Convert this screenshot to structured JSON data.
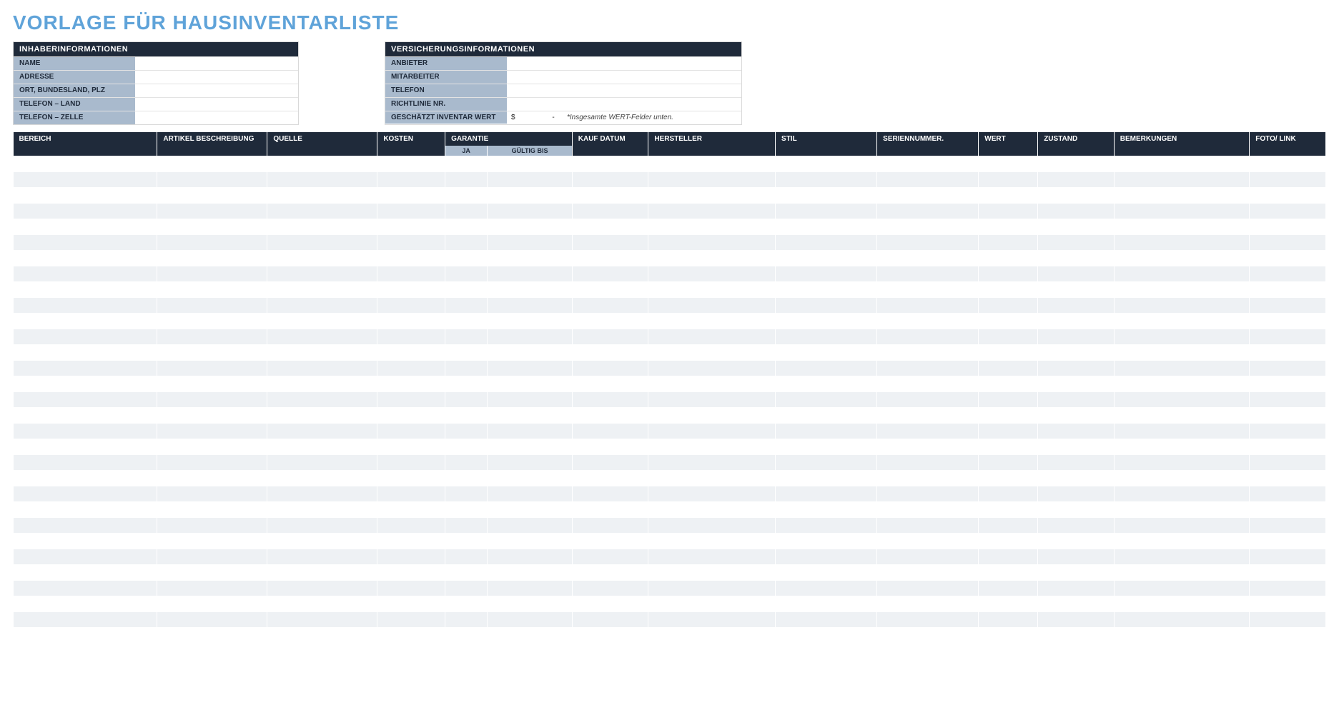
{
  "title": "VORLAGE FÜR HAUSINVENTARLISTE",
  "owner": {
    "header": "INHABERINFORMATIONEN",
    "rows": [
      {
        "label": "NAME",
        "value": ""
      },
      {
        "label": "ADRESSE",
        "value": ""
      },
      {
        "label": "ORT, BUNDESLAND, PLZ",
        "value": ""
      },
      {
        "label": "TELEFON – LAND",
        "value": ""
      },
      {
        "label": "TELEFON – ZELLE",
        "value": ""
      }
    ]
  },
  "insurance": {
    "header": "VERSICHERUNGSINFORMATIONEN",
    "rows": [
      {
        "label": "ANBIETER",
        "value": ""
      },
      {
        "label": "MITARBEITER",
        "value": ""
      },
      {
        "label": "TELEFON",
        "value": ""
      },
      {
        "label": "RICHTLINIE NR.",
        "value": ""
      }
    ],
    "estimate": {
      "label": "GESCHÄTZT INVENTAR WERT",
      "currency": "$",
      "amount": "-",
      "note": "*Insgesamte WERT-Felder unten."
    }
  },
  "table": {
    "headers": {
      "area": "BEREICH",
      "item": "ARTIKEL BESCHREIBUNG",
      "source": "QUELLE",
      "cost": "KOSTEN",
      "warranty": "GARANTIE",
      "warranty_yes": "JA",
      "warranty_til": "GÜLTIG BIS",
      "purchase": "KAUF DATUM",
      "manu": "HERSTELLER",
      "style": "STIL",
      "serial": "SERIENNUMMER.",
      "value": "WERT",
      "condition": "ZUSTAND",
      "notes": "BEMERKUNGEN",
      "photo": "FOTO/ LINK"
    },
    "row_count": 30,
    "column_count": 14
  }
}
